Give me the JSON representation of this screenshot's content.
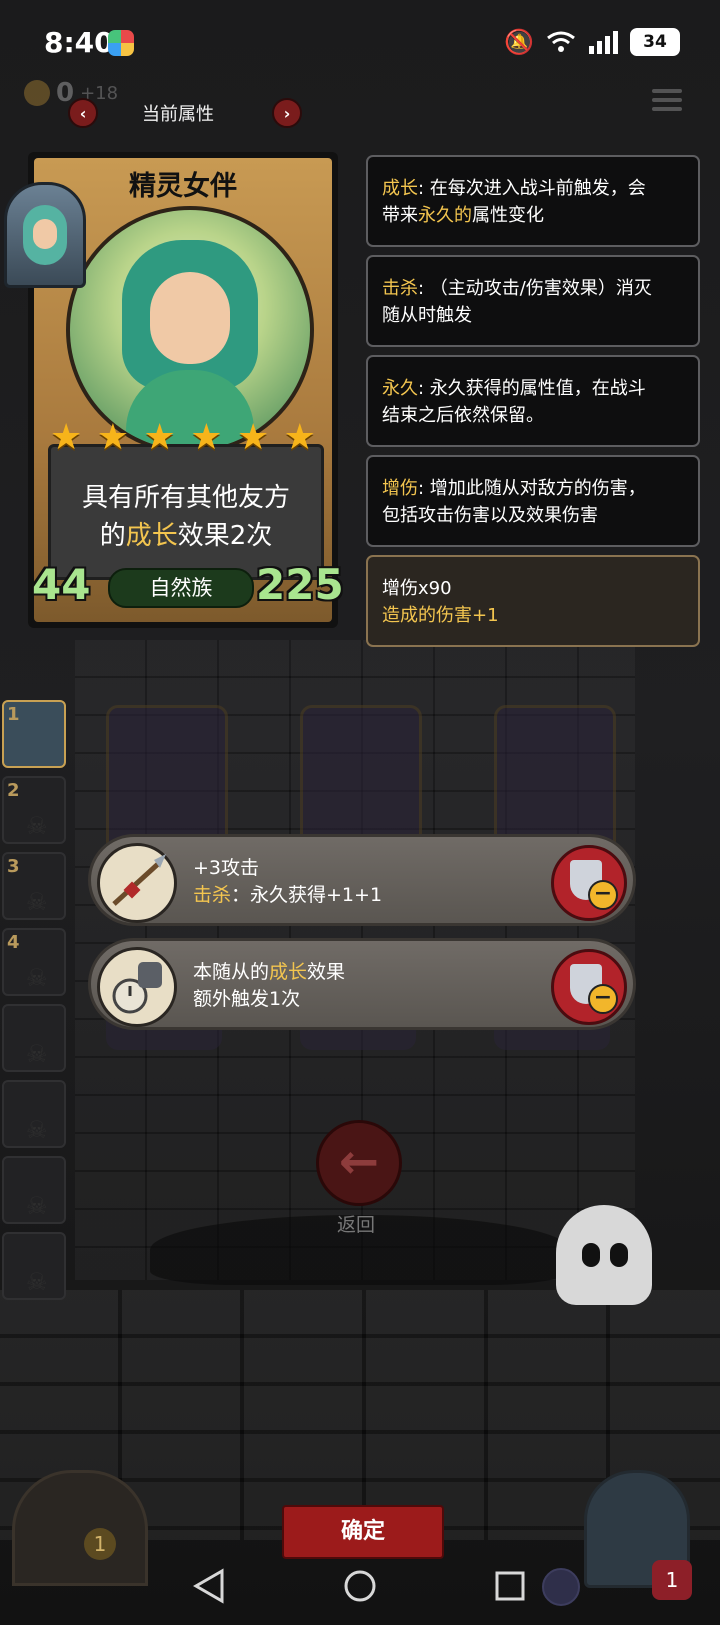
{
  "status_bar": {
    "time": "8:40",
    "battery": "34",
    "icons": [
      "app-badge-icon",
      "mute-icon",
      "wifi-icon",
      "signal-icon",
      "battery-icon"
    ]
  },
  "top_bar": {
    "gold_value": "0",
    "gold_bonus": "+18",
    "title": "当前属性",
    "prev_icon": "chevron-left-icon",
    "next_icon": "chevron-right-icon"
  },
  "hero_card": {
    "name": "精灵女伴",
    "stars": 6,
    "desc_line1": "具有所有其他友方",
    "desc_line2_pre": "的",
    "desc_line2_hl": "成长",
    "desc_line2_post": "效果2次",
    "attack": "44",
    "health": "225",
    "tribe": "自然族"
  },
  "keywords": [
    {
      "term": "成长",
      "sep": ": 在每次进入战斗前触发，会",
      "line2_pre": "带来",
      "line2_hl": "永久的",
      "line2_post": "属性变化"
    },
    {
      "term": "击杀",
      "sep": ": （主动攻击/伤害效果）消灭",
      "line2_pre": "随从时触发",
      "line2_hl": "",
      "line2_post": ""
    },
    {
      "term": "永久",
      "sep": ": 永久获得的属性值，在战斗",
      "line2_pre": "结束之后依然保留。",
      "line2_hl": "",
      "line2_post": ""
    },
    {
      "term": "增伤",
      "sep": ": 增加此随从对敌方的伤害，",
      "line2_pre": "包括攻击伤害以及效果伤害",
      "line2_hl": "",
      "line2_post": ""
    }
  ],
  "damage_box": {
    "line1": "增伤x90",
    "line2": "造成的伤害+1"
  },
  "roster": [
    {
      "num": "1",
      "active": true
    },
    {
      "num": "2",
      "active": false
    },
    {
      "num": "3",
      "active": false
    },
    {
      "num": "4",
      "active": false
    },
    {
      "num": "",
      "active": false
    },
    {
      "num": "",
      "active": false
    },
    {
      "num": "",
      "active": false
    },
    {
      "num": "",
      "active": false
    }
  ],
  "items": [
    {
      "line1": "+3攻击",
      "line2_hl": "击杀",
      "line2_post": "：永久获得+1+1",
      "icon": "spear-icon"
    },
    {
      "line1_pre": "本随从的",
      "line1_hl": "成长",
      "line1_post": "效果",
      "line2": "额外触发1次",
      "icon": "stopwatch-icon"
    }
  ],
  "back_label": "返回",
  "confirm_label": "确定",
  "door_badge": "1",
  "heart_value": "1",
  "colors": {
    "highlight": "#f3c54f",
    "confirm": "#9c1b1b",
    "stat_green": "#a9e58f"
  }
}
